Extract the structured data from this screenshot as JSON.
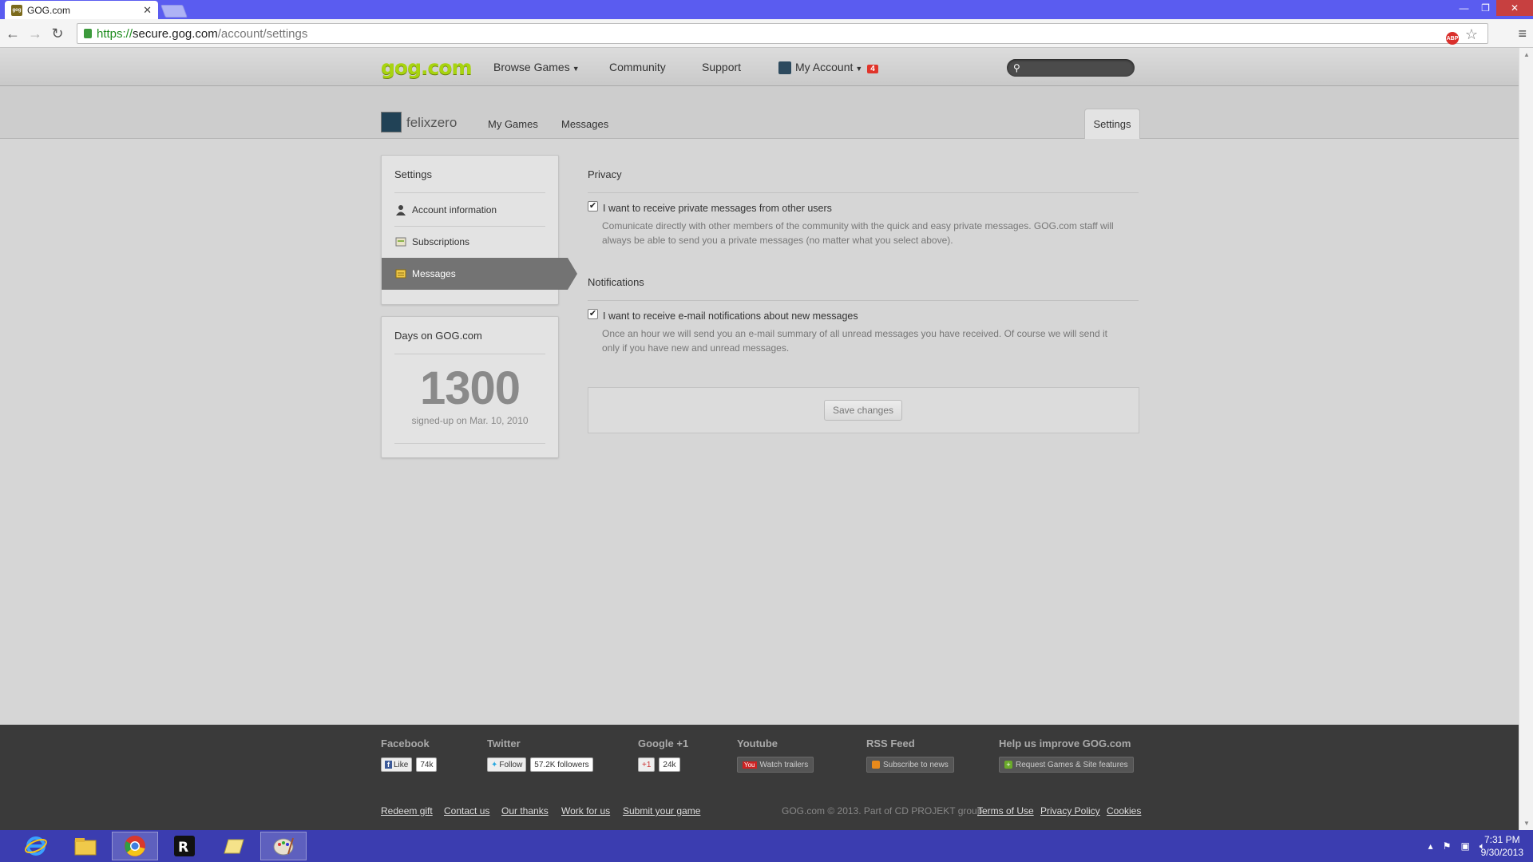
{
  "browser": {
    "tab_title": "GOG.com",
    "url": {
      "scheme": "https://",
      "host": "secure.gog.com",
      "path": "/account/settings"
    }
  },
  "header": {
    "logo": "gog.com",
    "nav": [
      "Browse Games",
      "Community",
      "Support"
    ],
    "account_label": "My Account",
    "account_badge": "4"
  },
  "userbar": {
    "username": "felixzero",
    "links": [
      "My Games",
      "Messages"
    ],
    "settings_tab": "Settings"
  },
  "sidebar": {
    "title": "Settings",
    "items": [
      {
        "label": "Account information",
        "icon": "user-icon"
      },
      {
        "label": "Subscriptions",
        "icon": "subscriptions-icon"
      },
      {
        "label": "Messages",
        "icon": "messages-icon",
        "active": true
      }
    ]
  },
  "days": {
    "title": "Days on GOG.com",
    "count": "1300",
    "signup": "signed-up on Mar. 10, 2010"
  },
  "privacy": {
    "title": "Privacy",
    "checkbox_label": "I want to receive private messages from other users",
    "checked": true,
    "desc_line1": "Comunicate directly with other members of the community with the quick and easy private messages. GOG.com staff will",
    "desc_line2": "always be able to send you a private messages (no matter what you select above)."
  },
  "notifications": {
    "title": "Notifications",
    "checkbox_label": "I want to receive e-mail notifications about new messages",
    "checked": true,
    "desc_line1": "Once an hour we will send you an e-mail summary of all unread messages you have received. Of course we will send it",
    "desc_line2": "only if you have new and unread messages."
  },
  "save_label": "Save changes",
  "footer": {
    "facebook": {
      "title": "Facebook",
      "button": "Like",
      "count": "74k"
    },
    "twitter": {
      "title": "Twitter",
      "button": "Follow",
      "count": "57.2K followers"
    },
    "google": {
      "title": "Google +1",
      "button": "+1",
      "count": "24k"
    },
    "youtube": {
      "title": "Youtube",
      "button": "Watch trailers"
    },
    "rss": {
      "title": "RSS Feed",
      "button": "Subscribe to news"
    },
    "help": {
      "title": "Help us improve GOG.com",
      "button": "Request Games & Site features"
    },
    "links_left": [
      "Redeem gift",
      "Contact us",
      "Our thanks",
      "Work for us",
      "Submit your game"
    ],
    "copyright": "GOG.com © 2013. Part of CD PROJEKT group.",
    "links_right": [
      "Terms of Use",
      "Privacy Policy",
      "Cookies"
    ]
  },
  "taskbar": {
    "time": "7:31 PM",
    "date": "9/30/2013"
  },
  "colors": {
    "titlebar": "#5a5cf0",
    "taskbar": "#3b3db0",
    "logo_green": "#a8d40f",
    "badge_red": "#e0342a",
    "active_item": "#737373"
  }
}
